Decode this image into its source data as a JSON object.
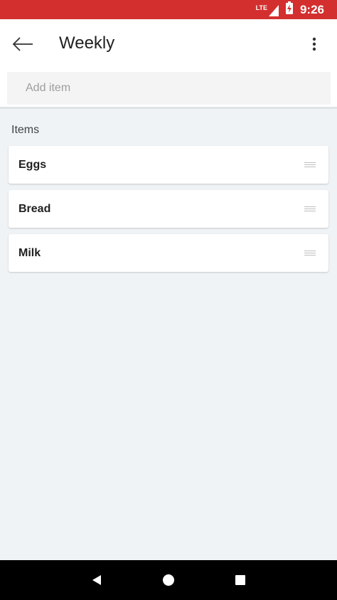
{
  "status_bar": {
    "network": "LTE",
    "time": "9:26",
    "icons": [
      "signal-icon",
      "battery-charging-icon"
    ]
  },
  "app_bar": {
    "title": "Weekly",
    "back_icon": "arrow-back-icon",
    "menu_icon": "more-vert-icon"
  },
  "add_item": {
    "placeholder": "Add item",
    "value": ""
  },
  "section": {
    "label": "Items"
  },
  "items": [
    {
      "label": "Eggs"
    },
    {
      "label": "Bread"
    },
    {
      "label": "Milk"
    }
  ],
  "nav_bar": {
    "icons": [
      "back-triangle-icon",
      "home-circle-icon",
      "recents-square-icon"
    ]
  },
  "colors": {
    "status_bar": "#d32f2f",
    "background": "#eff3f6",
    "card": "#ffffff"
  }
}
